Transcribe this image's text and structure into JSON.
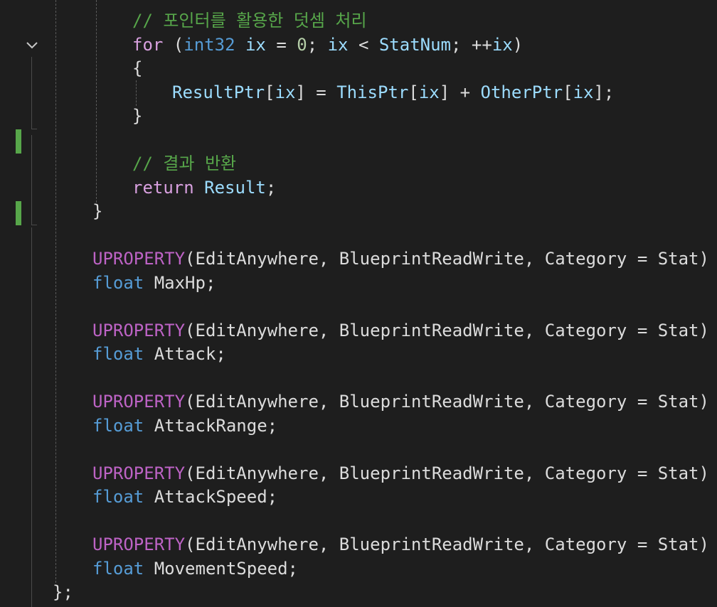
{
  "editor": {
    "lines": [
      [
        {
          "t": "// 포인터를 활용한 덧셈 처리",
          "c": "comment"
        }
      ],
      [
        {
          "t": "for",
          "c": "keyword"
        },
        {
          "t": " (",
          "c": "plain"
        },
        {
          "t": "int32",
          "c": "type"
        },
        {
          "t": " ",
          "c": "plain"
        },
        {
          "t": "ix",
          "c": "ident"
        },
        {
          "t": " = ",
          "c": "plain"
        },
        {
          "t": "0",
          "c": "number"
        },
        {
          "t": "; ",
          "c": "plain"
        },
        {
          "t": "ix",
          "c": "ident"
        },
        {
          "t": " < ",
          "c": "plain"
        },
        {
          "t": "StatNum",
          "c": "ident"
        },
        {
          "t": "; ++",
          "c": "plain"
        },
        {
          "t": "ix",
          "c": "ident"
        },
        {
          "t": ")",
          "c": "plain"
        }
      ],
      [
        {
          "t": "{",
          "c": "plain"
        }
      ],
      [
        {
          "t": "ResultPtr",
          "c": "ident"
        },
        {
          "t": "[",
          "c": "plain"
        },
        {
          "t": "ix",
          "c": "ident"
        },
        {
          "t": "] = ",
          "c": "plain"
        },
        {
          "t": "ThisPtr",
          "c": "ident"
        },
        {
          "t": "[",
          "c": "plain"
        },
        {
          "t": "ix",
          "c": "ident"
        },
        {
          "t": "] + ",
          "c": "plain"
        },
        {
          "t": "OtherPtr",
          "c": "ident"
        },
        {
          "t": "[",
          "c": "plain"
        },
        {
          "t": "ix",
          "c": "ident"
        },
        {
          "t": "];",
          "c": "plain"
        }
      ],
      [
        {
          "t": "}",
          "c": "plain"
        }
      ],
      [],
      [
        {
          "t": "// 결과 반환",
          "c": "comment"
        }
      ],
      [
        {
          "t": "return",
          "c": "keyword"
        },
        {
          "t": " ",
          "c": "plain"
        },
        {
          "t": "Result",
          "c": "ident"
        },
        {
          "t": ";",
          "c": "plain"
        }
      ],
      [
        {
          "t": "}",
          "c": "plain"
        }
      ],
      [],
      [
        {
          "t": "UPROPERTY",
          "c": "macro"
        },
        {
          "t": "(EditAnywhere, BlueprintReadWrite, Category = Stat)",
          "c": "plain"
        }
      ],
      [
        {
          "t": "float",
          "c": "type"
        },
        {
          "t": " MaxHp;",
          "c": "plain"
        }
      ],
      [],
      [
        {
          "t": "UPROPERTY",
          "c": "macro"
        },
        {
          "t": "(EditAnywhere, BlueprintReadWrite, Category = Stat)",
          "c": "plain"
        }
      ],
      [
        {
          "t": "float",
          "c": "type"
        },
        {
          "t": " Attack;",
          "c": "plain"
        }
      ],
      [],
      [
        {
          "t": "UPROPERTY",
          "c": "macro"
        },
        {
          "t": "(EditAnywhere, BlueprintReadWrite, Category = Stat)",
          "c": "plain"
        }
      ],
      [
        {
          "t": "float",
          "c": "type"
        },
        {
          "t": " AttackRange;",
          "c": "plain"
        }
      ],
      [],
      [
        {
          "t": "UPROPERTY",
          "c": "macro"
        },
        {
          "t": "(EditAnywhere, BlueprintReadWrite, Category = Stat)",
          "c": "plain"
        }
      ],
      [
        {
          "t": "float",
          "c": "type"
        },
        {
          "t": " AttackSpeed;",
          "c": "plain"
        }
      ],
      [],
      [
        {
          "t": "UPROPERTY",
          "c": "macro"
        },
        {
          "t": "(EditAnywhere, BlueprintReadWrite, Category = Stat)",
          "c": "plain"
        }
      ],
      [
        {
          "t": "float",
          "c": "type"
        },
        {
          "t": " MovementSpeed;",
          "c": "plain"
        }
      ],
      [
        {
          "t": "};",
          "c": "plain"
        }
      ]
    ]
  },
  "gutter": {
    "fold_icon": "chevron-down-icon",
    "change_marker_color": "#57a64a"
  },
  "colors": {
    "background": "#1e1e1e",
    "comment": "#57a64a",
    "keyword": "#d8a0df",
    "type": "#569cd6",
    "number": "#b5cea8",
    "identifier": "#9cdcfe",
    "macro": "#bd63c5",
    "plain": "#dcdcdc"
  }
}
